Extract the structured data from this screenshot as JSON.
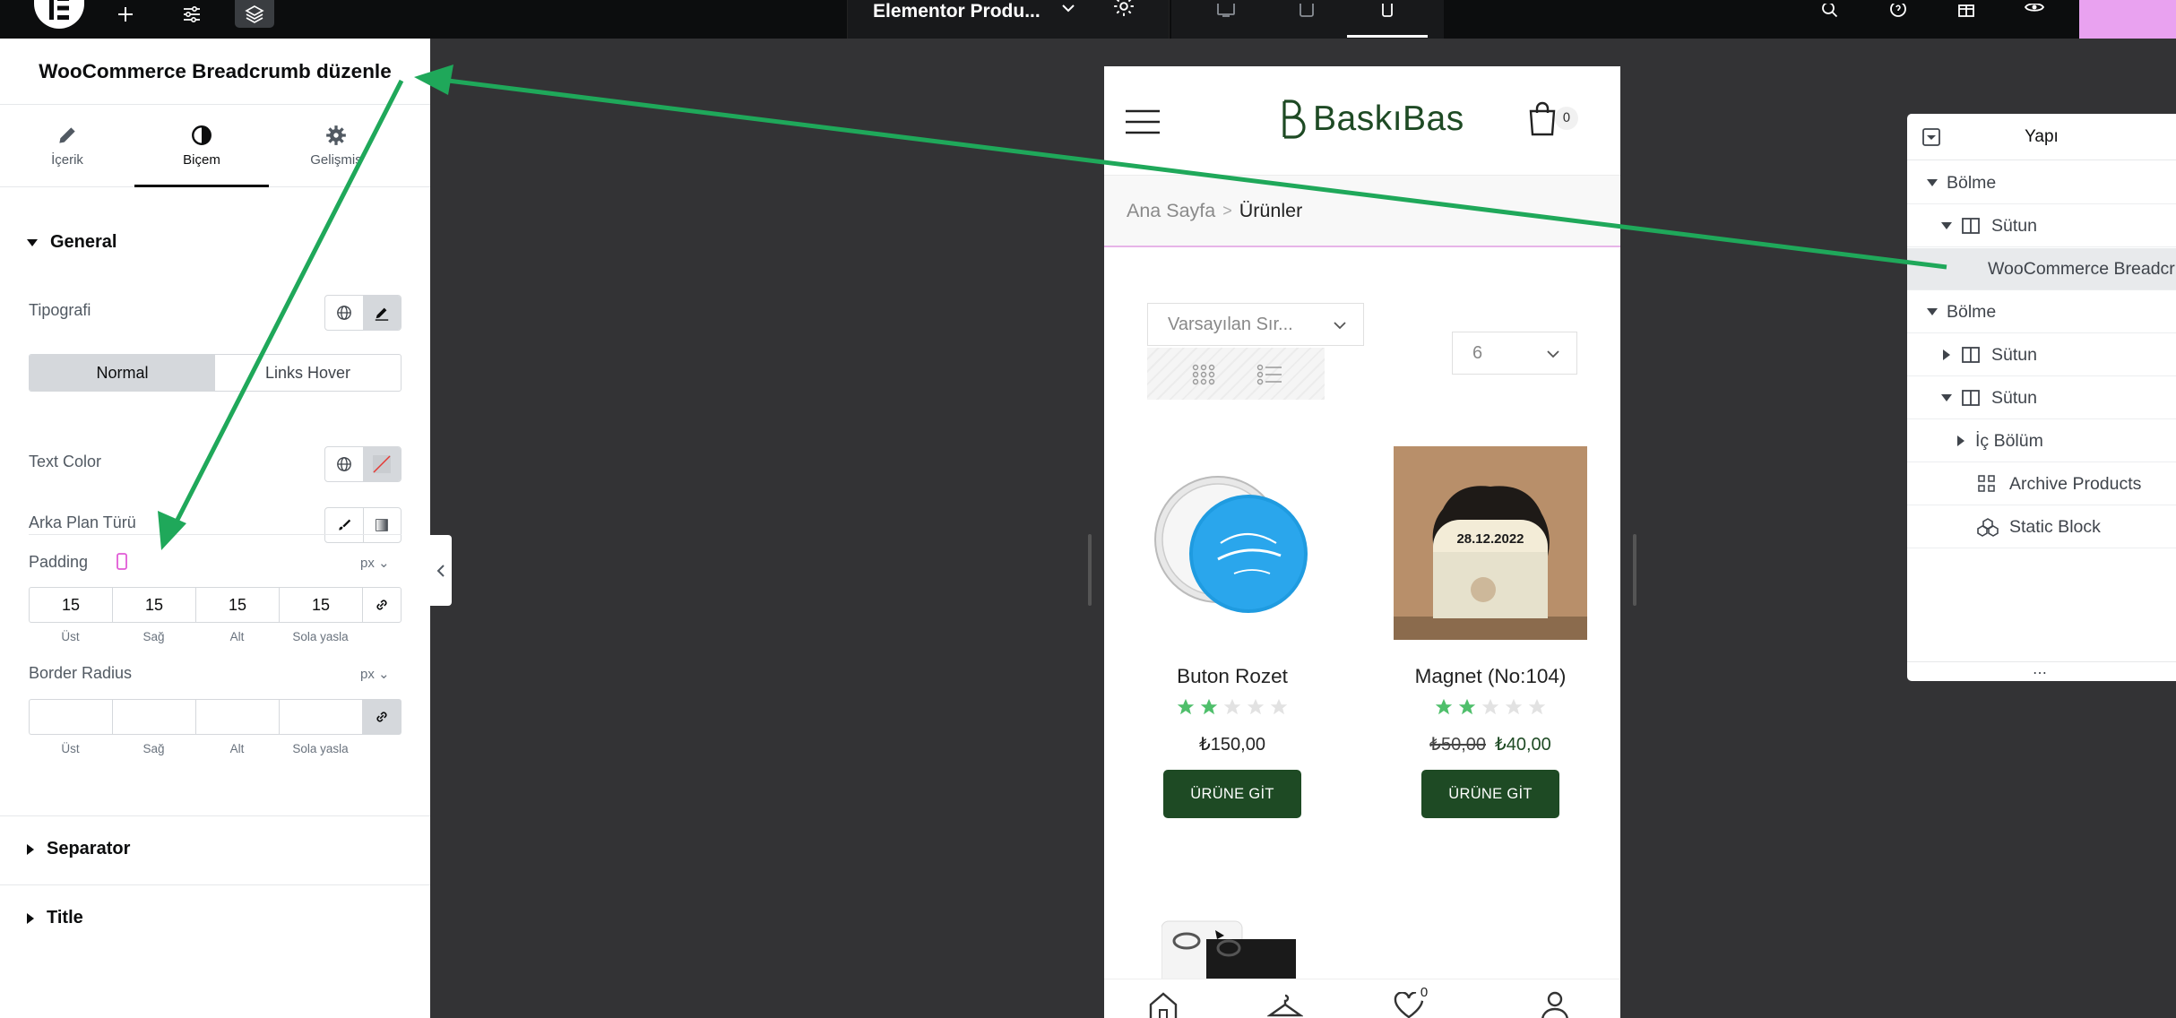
{
  "colors": {
    "brand_green": "#1e4a24",
    "arrow_green": "#1fa85a",
    "accent_pink": "#e77fe8",
    "star_green": "#4fbf6b"
  },
  "topbar": {
    "doc_title": "Elementor Produ..."
  },
  "panel": {
    "title": "WooCommerce Breadcrumb düzenle",
    "tabs": [
      {
        "label": "İçerik",
        "icon": "pencil-icon"
      },
      {
        "label": "Biçem",
        "icon": "half-circle-icon"
      },
      {
        "label": "Gelişmiş",
        "icon": "gear-icon"
      }
    ],
    "general": {
      "heading": "General",
      "typography_label": "Tipografi",
      "states": [
        "Normal",
        "Links Hover"
      ],
      "text_color_label": "Text Color",
      "background_type_label": "Arka Plan Türü",
      "padding_label": "Padding",
      "padding_unit": "px",
      "padding_values": [
        "15",
        "15",
        "15",
        "15"
      ],
      "dim_labels": [
        "Üst",
        "Sağ",
        "Alt",
        "Sola yasla"
      ],
      "border_radius_label": "Border Radius",
      "border_radius_unit": "px",
      "border_radius_values": [
        "",
        "",
        "",
        ""
      ]
    },
    "separator_heading": "Separator",
    "title_heading": "Title"
  },
  "preview": {
    "logo_text": "BaskıBas",
    "cart_count": "0",
    "breadcrumb": {
      "home": "Ana Sayfa",
      "separator": ">",
      "current": "Ürünler"
    },
    "sort_value": "Varsayılan Sır...",
    "per_page_value": "6",
    "products": [
      {
        "name": "Buton Rozet",
        "rating": 2,
        "price": "₺150,00",
        "old_price": "",
        "cta": "ÜRÜNE GİT"
      },
      {
        "name": "Magnet (No:104)",
        "rating": 2,
        "price": "₺40,00",
        "old_price": "₺50,00",
        "cta": "ÜRÜNE GİT",
        "image_text": "28.12.2022"
      }
    ],
    "wishlist_count": "0"
  },
  "navigator": {
    "title": "Yapı",
    "rows": [
      {
        "label": "Bölme",
        "icon": "none"
      },
      {
        "label": "Sütun",
        "icon": "column-icon"
      },
      {
        "label": "WooCommerce Breadcrumb",
        "icon": "breadcrumb-icon"
      },
      {
        "label": "Bölme",
        "icon": "none"
      },
      {
        "label": "Sütun",
        "icon": "column-icon"
      },
      {
        "label": "Sütun",
        "icon": "column-icon"
      },
      {
        "label": "İç Bölüm",
        "icon": "none"
      },
      {
        "label": "Archive Products",
        "icon": "products-icon"
      },
      {
        "label": "Static Block",
        "icon": "block-icon"
      }
    ]
  }
}
